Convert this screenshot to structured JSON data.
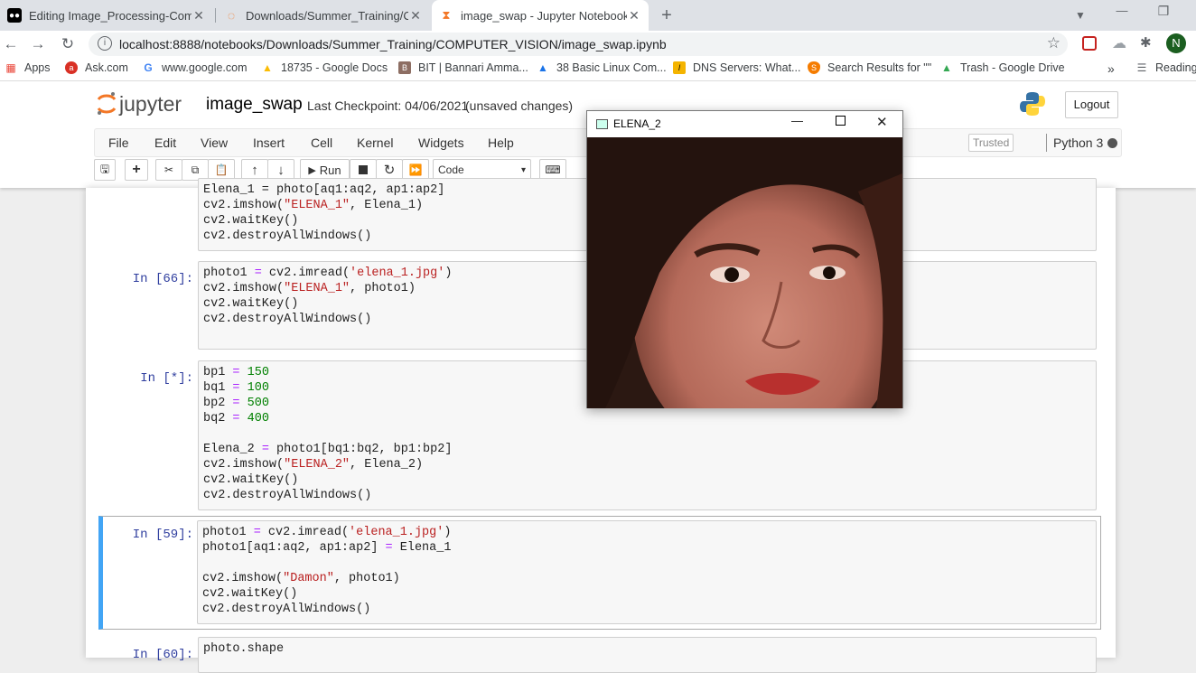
{
  "browser": {
    "tabs": [
      {
        "label": "Editing Image_Processing-Comp",
        "icon": "medium-icon"
      },
      {
        "label": "Downloads/Summer_Training/CO",
        "icon": "jupyter-tab-icon"
      },
      {
        "label": "image_swap - Jupyter Notebook",
        "icon": "hourglass-icon"
      }
    ],
    "url": "localhost:8888/notebooks/Downloads/Summer_Training/COMPUTER_VISION/image_swap.ipynb",
    "profile_initial": "N",
    "bookmarks": [
      {
        "label": "Apps",
        "icon": "apps-grid-icon",
        "color": "#e94235"
      },
      {
        "label": "Ask.com",
        "icon": "ask-icon",
        "color": "#d93025"
      },
      {
        "label": "www.google.com",
        "icon": "google-icon",
        "color": "#4285f4"
      },
      {
        "label": "18735 - Google Docs",
        "icon": "drive-icon",
        "color": "#fbbc04"
      },
      {
        "label": "BIT | Bannari Amma...",
        "icon": "bit-icon",
        "color": "#8d6e63"
      },
      {
        "label": "38 Basic Linux Com...",
        "icon": "linux-icon",
        "color": "#5f6368"
      },
      {
        "label": "DNS Servers: What...",
        "icon": "l-icon",
        "color": "#f4b400"
      },
      {
        "label": "Search Results for \"\"",
        "icon": "shield-icon",
        "color": "#f57c00"
      },
      {
        "label": "Trash - Google Drive",
        "icon": "drive-icon",
        "color": "#34a853"
      }
    ],
    "reading_list": "Reading"
  },
  "jupyter": {
    "logo_text": "jupyter",
    "notebook_name": "image_swap",
    "checkpoint": "Last Checkpoint: 04/06/2021",
    "status": "(unsaved changes)",
    "logout": "Logout",
    "menus": [
      "File",
      "Edit",
      "View",
      "Insert",
      "Cell",
      "Kernel",
      "Widgets",
      "Help"
    ],
    "trusted": "Trusted",
    "kernel": "Python 3",
    "run_label": "Run",
    "cell_type": "Code"
  },
  "cells": [
    {
      "prompt": "",
      "lines": [
        [
          [
            "Elena_1 = photo[aq1:aq2, ap1:ap2]",
            ""
          ]
        ],
        [
          [
            "cv2.imshow(",
            ""
          ],
          [
            "\"ELENA_1\"",
            "s"
          ],
          [
            ", Elena_1)",
            ""
          ]
        ],
        [
          [
            "cv2.waitKey()",
            ""
          ]
        ],
        [
          [
            "cv2.destroyAllWindows()",
            ""
          ]
        ]
      ]
    },
    {
      "prompt": "In [66]:",
      "lines": [
        [
          [
            "photo1 ",
            ""
          ],
          [
            "=",
            "o"
          ],
          [
            " cv2.imread(",
            ""
          ],
          [
            "'elena_1.jpg'",
            "s"
          ],
          [
            ")",
            ""
          ]
        ],
        [
          [
            "cv2.imshow(",
            ""
          ],
          [
            "\"ELENA_1\"",
            "s"
          ],
          [
            ", photo1)",
            ""
          ]
        ],
        [
          [
            "cv2.waitKey()",
            ""
          ]
        ],
        [
          [
            "cv2.destroyAllWindows()",
            ""
          ]
        ],
        [
          [
            "",
            ""
          ]
        ]
      ]
    },
    {
      "prompt": "In [*]:",
      "lines": [
        [
          [
            "bp1 ",
            ""
          ],
          [
            "=",
            "o"
          ],
          [
            " ",
            ""
          ],
          [
            "150",
            "n"
          ]
        ],
        [
          [
            "bq1 ",
            ""
          ],
          [
            "=",
            "o"
          ],
          [
            " ",
            ""
          ],
          [
            "100",
            "n"
          ]
        ],
        [
          [
            "bp2 ",
            ""
          ],
          [
            "=",
            "o"
          ],
          [
            " ",
            ""
          ],
          [
            "500",
            "n"
          ]
        ],
        [
          [
            "bq2 ",
            ""
          ],
          [
            "=",
            "o"
          ],
          [
            " ",
            ""
          ],
          [
            "400",
            "n"
          ]
        ],
        [
          [
            "",
            ""
          ]
        ],
        [
          [
            "Elena_2 ",
            ""
          ],
          [
            "=",
            "o"
          ],
          [
            " photo1[bq1:bq2, bp1:bp2]",
            ""
          ]
        ],
        [
          [
            "cv2.imshow(",
            ""
          ],
          [
            "\"ELENA_2\"",
            "s"
          ],
          [
            ", Elena_2)",
            ""
          ]
        ],
        [
          [
            "cv2.waitKey()",
            ""
          ]
        ],
        [
          [
            "cv2.destroyAllWindows()",
            ""
          ]
        ]
      ]
    },
    {
      "prompt": "In [59]:",
      "lines": [
        [
          [
            "photo1 ",
            ""
          ],
          [
            "=",
            "o"
          ],
          [
            " cv2.imread(",
            ""
          ],
          [
            "'elena_1.jpg'",
            "s"
          ],
          [
            ")",
            ""
          ]
        ],
        [
          [
            "photo1[aq1:aq2, ap1:ap2] ",
            ""
          ],
          [
            "=",
            "o"
          ],
          [
            " Elena_1",
            ""
          ]
        ],
        [
          [
            "",
            ""
          ]
        ],
        [
          [
            "cv2.imshow(",
            ""
          ],
          [
            "\"Damon\"",
            "s"
          ],
          [
            ", photo1)",
            ""
          ]
        ],
        [
          [
            "cv2.waitKey()",
            ""
          ]
        ],
        [
          [
            "cv2.destroyAllWindows()",
            ""
          ]
        ]
      ]
    },
    {
      "prompt": "In [60]:",
      "lines": [
        [
          [
            "photo.shape",
            ""
          ]
        ]
      ]
    }
  ],
  "opencv_window": {
    "title": "ELENA_2"
  },
  "colors": {
    "accent": "#42a5f5",
    "prompt": "#303f9f",
    "string": "#ba2121",
    "number": "#008000"
  }
}
